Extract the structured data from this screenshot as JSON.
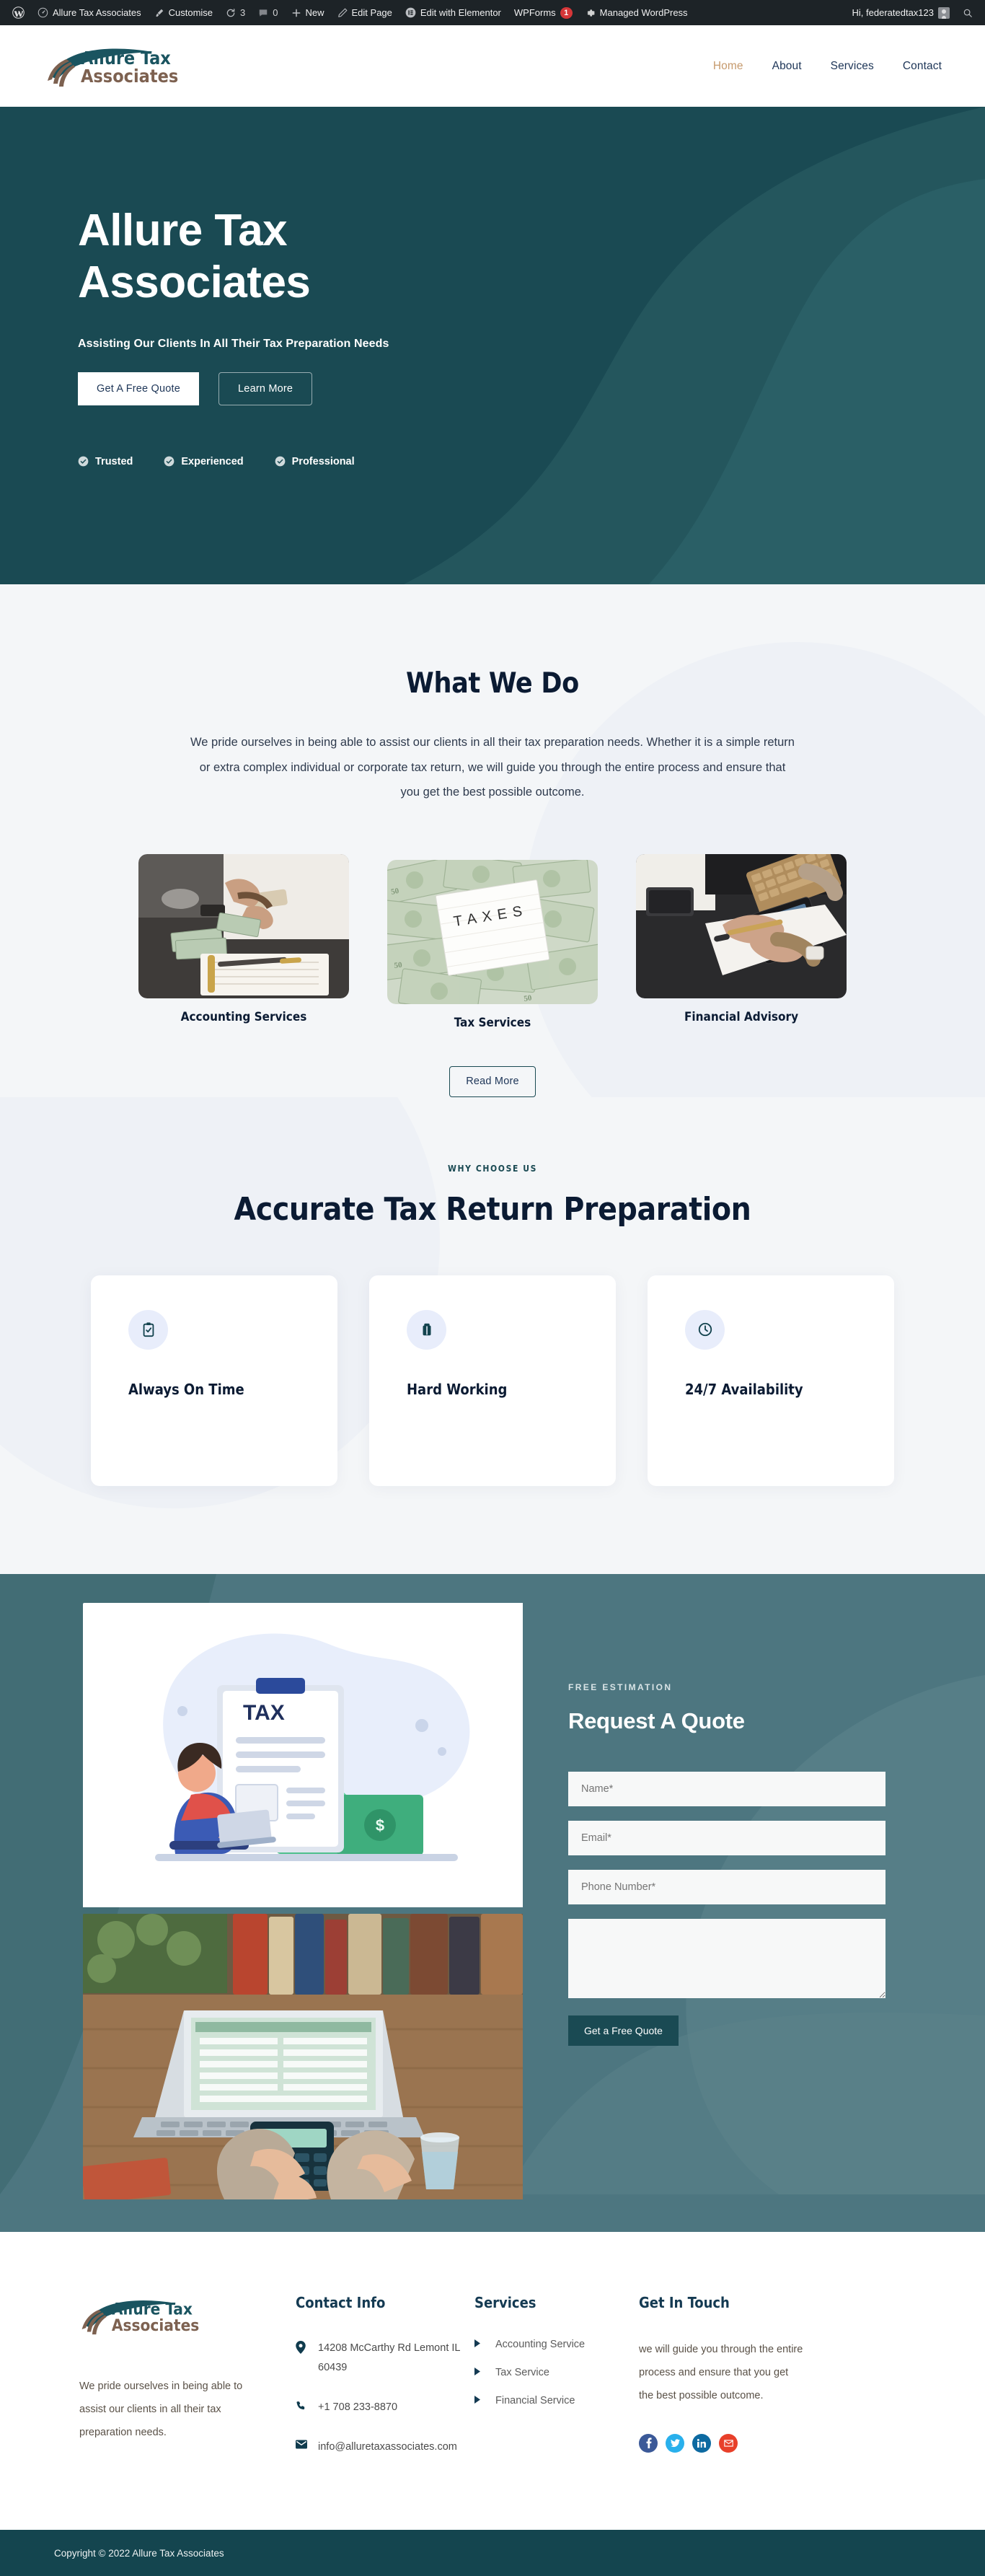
{
  "adminbar": {
    "wp_logo": "wordpress-icon",
    "items": [
      {
        "icon": "dashboard-icon",
        "label": "Allure Tax Associates",
        "name": "adminbar-site-name"
      },
      {
        "icon": "paintbrush-icon",
        "label": "Customise",
        "name": "adminbar-customise"
      },
      {
        "icon": "updates-icon",
        "label": "3",
        "name": "adminbar-updates"
      },
      {
        "icon": "comment-icon",
        "label": "0",
        "name": "adminbar-comments"
      },
      {
        "icon": "plus-icon",
        "label": "New",
        "name": "adminbar-new"
      },
      {
        "icon": "pencil-icon",
        "label": "Edit Page",
        "name": "adminbar-edit-page"
      },
      {
        "icon": "elementor-icon",
        "label": "Edit with Elementor",
        "name": "adminbar-edit-elementor"
      },
      {
        "icon": "none",
        "label": "WPForms",
        "badge": "1",
        "name": "adminbar-wpforms"
      },
      {
        "icon": "gear-icon",
        "label": "Managed WordPress",
        "name": "adminbar-managed-wordpress"
      }
    ],
    "greeting": "Hi, federatedtax123",
    "search_icon": "search-icon"
  },
  "header": {
    "logo_line1": "Allure Tax",
    "logo_line2": "Associates",
    "nav": [
      {
        "label": "Home",
        "active": true
      },
      {
        "label": "About",
        "active": false
      },
      {
        "label": "Services",
        "active": false
      },
      {
        "label": "Contact",
        "active": false
      }
    ]
  },
  "hero": {
    "title": "Allure Tax Associates",
    "subtitle": "Assisting Our Clients In All Their Tax Preparation Needs",
    "primary_button": "Get A Free Quote",
    "secondary_button": "Learn More",
    "badges": [
      "Trusted",
      "Experienced",
      "Professional"
    ],
    "bg_color": "#1a4a53"
  },
  "what_we_do": {
    "title": "What We Do",
    "paragraph": "We pride ourselves in being able to assist our clients in all their tax preparation needs. Whether it is a simple return or extra complex individual or corporate tax return, we will guide you through the entire process and ensure that you get the best possible outcome.",
    "cards": [
      {
        "label": "Accounting Services",
        "image": "hands-counting-cash-photo"
      },
      {
        "label": "Tax Services",
        "image": "taxes-sign-on-dollar-bills-photo"
      },
      {
        "label": "Financial Advisory",
        "image": "desk-calculator-keyboard-photo"
      }
    ],
    "read_more": "Read More"
  },
  "why_choose": {
    "eyebrow": "WHY CHOOSE US",
    "title": "Accurate Tax Return Preparation",
    "features": [
      {
        "icon": "clipboard-check-icon",
        "label": "Always On Time"
      },
      {
        "icon": "briefcase-icon",
        "label": "Hard Working"
      },
      {
        "icon": "clock-icon",
        "label": "24/7 Availability"
      }
    ]
  },
  "quote_section": {
    "eyebrow": "FREE ESTIMATION",
    "title": "Request A Quote",
    "fields": [
      {
        "name": "name",
        "placeholder": "Name*"
      },
      {
        "name": "email",
        "placeholder": "Email*"
      },
      {
        "name": "phone",
        "placeholder": "Phone Number*"
      }
    ],
    "message_placeholder": "",
    "submit_label": "Get a Free Quote",
    "images": [
      "tax-clipboard-illustration",
      "laptop-calculator-desk-photo"
    ],
    "bg_color": "#4d7680"
  },
  "footer": {
    "logo_line1": "Allure Tax",
    "logo_line2": "Associates",
    "about_text": "We pride ourselves in being able to assist our clients in all their tax preparation needs.",
    "contact": {
      "heading": "Contact Info",
      "items": [
        {
          "icon": "map-pin-icon",
          "text": "14208 McCarthy Rd Lemont IL 60439"
        },
        {
          "icon": "phone-icon",
          "text": "+1 708 233-8870"
        },
        {
          "icon": "envelope-icon",
          "text": "info@alluretaxassociates.com"
        }
      ]
    },
    "services": {
      "heading": "Services",
      "items": [
        "Accounting Service",
        "Tax Service",
        "Financial Service"
      ]
    },
    "get_in_touch": {
      "heading": "Get In Touch",
      "text": " we will guide you through the entire process and ensure that you get the best possible outcome.",
      "socials": [
        {
          "name": "facebook-icon",
          "color": "#3b5998"
        },
        {
          "name": "twitter-icon",
          "color": "#29b0ec"
        },
        {
          "name": "linkedin-icon",
          "color": "#0d6aa1"
        },
        {
          "name": "email-icon",
          "color": "#e8402a"
        }
      ]
    },
    "copyright": "Copyright © 2022 Allure Tax Associates",
    "copyright_bg": "#14454f"
  }
}
